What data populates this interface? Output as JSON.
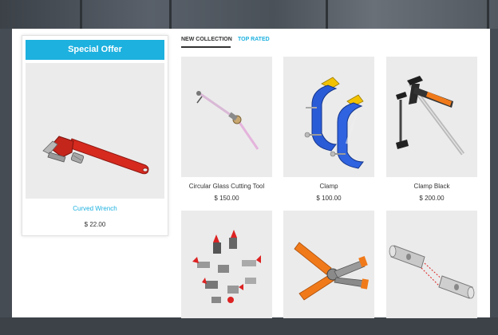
{
  "offer": {
    "header": "Special Offer",
    "product_name": "Curved Wrench",
    "price": "$ 22.00",
    "image_icon": "pipe-wrench-icon"
  },
  "tabs": [
    {
      "label": "NEW COLLECTION",
      "active": true
    },
    {
      "label": "TOP RATED",
      "active": false
    }
  ],
  "products": [
    {
      "name": "Circular Glass Cutting Tool",
      "price": "$ 150.00",
      "icon": "glass-cutter-icon"
    },
    {
      "name": "Clamp",
      "price": "$ 100.00",
      "icon": "c-clamp-icon"
    },
    {
      "name": "Clamp Black",
      "price": "$ 200.00",
      "icon": "bar-clamp-icon"
    },
    {
      "name": "",
      "price": "",
      "icon": "toggle-clamps-icon"
    },
    {
      "name": "",
      "price": "",
      "icon": "spring-clamp-icon"
    },
    {
      "name": "",
      "price": "",
      "icon": "socket-tubes-icon"
    }
  ],
  "colors": {
    "accent": "#1db1df",
    "text": "#333333",
    "image_bg": "#ebebeb"
  }
}
